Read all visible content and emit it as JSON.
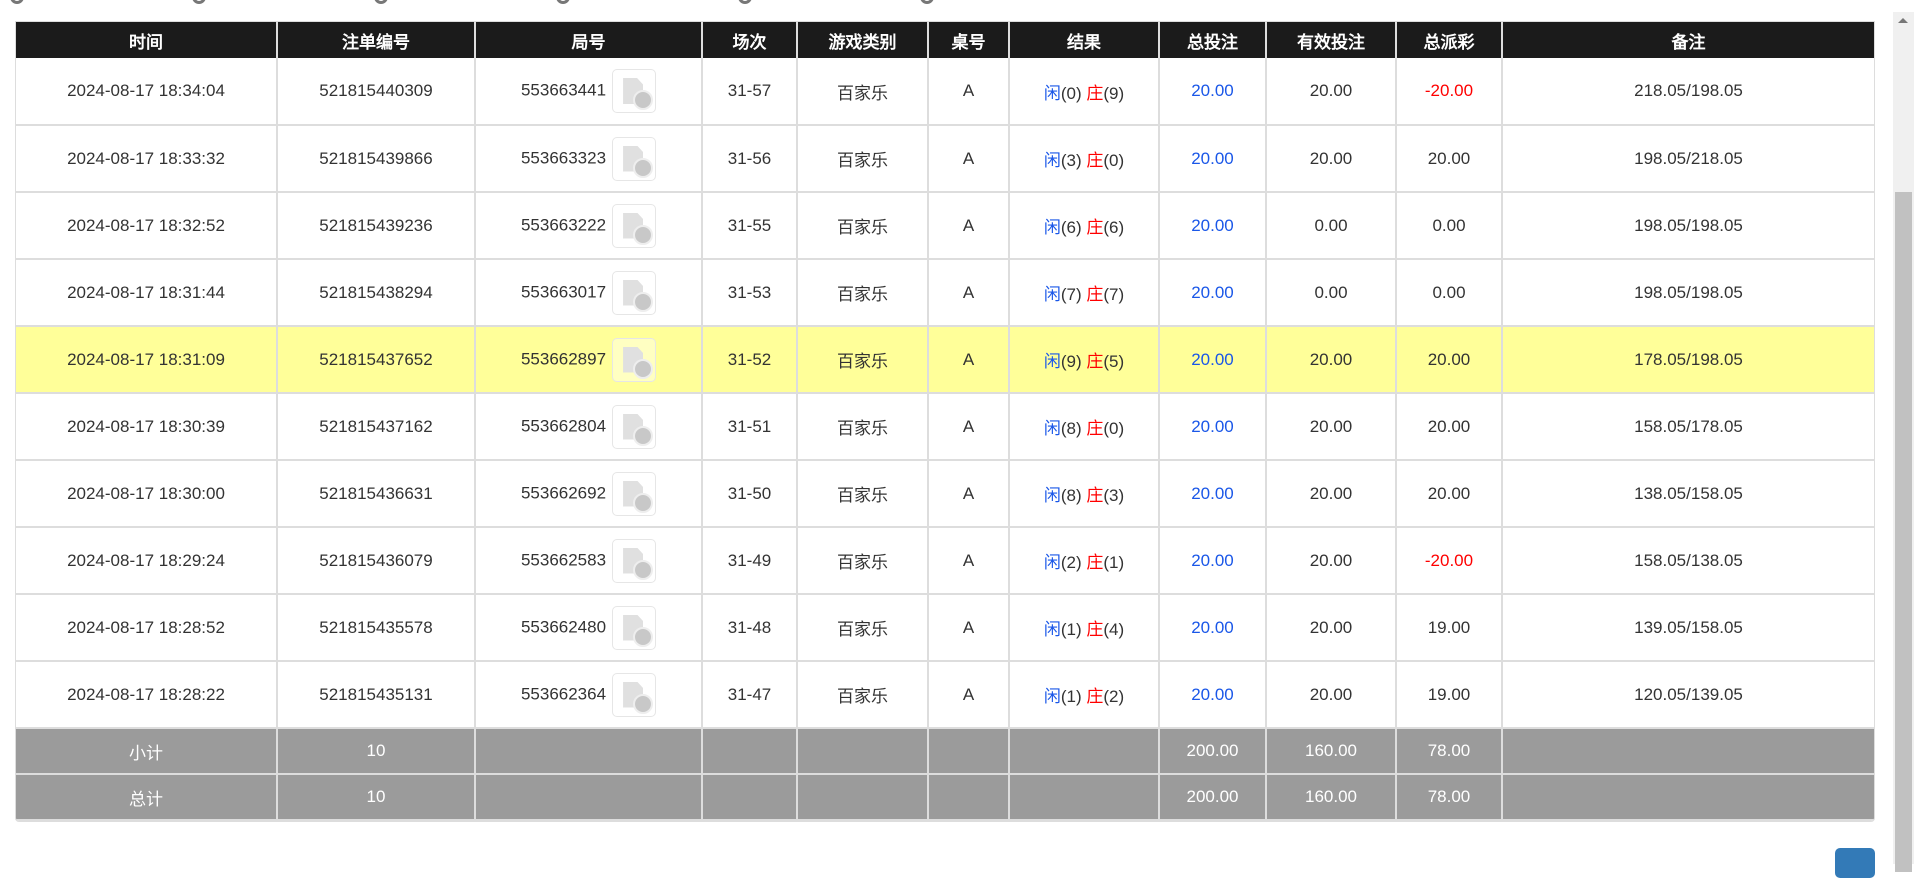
{
  "columns": [
    "时间",
    "注单编号",
    "局号",
    "场次",
    "游戏类别",
    "桌号",
    "结果",
    "总投注",
    "有效投注",
    "总派彩",
    "备注"
  ],
  "rows": [
    {
      "time": "2024-08-17 18:34:04",
      "bet_id": "521815440309",
      "round": "553663441",
      "session": "31-57",
      "game": "百家乐",
      "table": "A",
      "player": "闲",
      "player_pts": "(0)",
      "banker": "庄",
      "banker_pts": "(9)",
      "total_bet": "20.00",
      "valid_bet": "20.00",
      "payout": "-20.00",
      "payout_negative": true,
      "note": "218.05/198.05"
    },
    {
      "time": "2024-08-17 18:33:32",
      "bet_id": "521815439866",
      "round": "553663323",
      "session": "31-56",
      "game": "百家乐",
      "table": "A",
      "player": "闲",
      "player_pts": "(3)",
      "banker": "庄",
      "banker_pts": "(0)",
      "total_bet": "20.00",
      "valid_bet": "20.00",
      "payout": "20.00",
      "note": "198.05/218.05"
    },
    {
      "time": "2024-08-17 18:32:52",
      "bet_id": "521815439236",
      "round": "553663222",
      "session": "31-55",
      "game": "百家乐",
      "table": "A",
      "player": "闲",
      "player_pts": "(6)",
      "banker": "庄",
      "banker_pts": "(6)",
      "total_bet": "20.00",
      "valid_bet": "0.00",
      "payout": "0.00",
      "note": "198.05/198.05"
    },
    {
      "time": "2024-08-17 18:31:44",
      "bet_id": "521815438294",
      "round": "553663017",
      "session": "31-53",
      "game": "百家乐",
      "table": "A",
      "player": "闲",
      "player_pts": "(7)",
      "banker": "庄",
      "banker_pts": "(7)",
      "total_bet": "20.00",
      "valid_bet": "0.00",
      "payout": "0.00",
      "note": "198.05/198.05"
    },
    {
      "time": "2024-08-17 18:31:09",
      "bet_id": "521815437652",
      "round": "553662897",
      "session": "31-52",
      "game": "百家乐",
      "table": "A",
      "player": "闲",
      "player_pts": "(9)",
      "banker": "庄",
      "banker_pts": "(5)",
      "total_bet": "20.00",
      "valid_bet": "20.00",
      "payout": "20.00",
      "note": "178.05/198.05",
      "highlighted": true
    },
    {
      "time": "2024-08-17 18:30:39",
      "bet_id": "521815437162",
      "round": "553662804",
      "session": "31-51",
      "game": "百家乐",
      "table": "A",
      "player": "闲",
      "player_pts": "(8)",
      "banker": "庄",
      "banker_pts": "(0)",
      "total_bet": "20.00",
      "valid_bet": "20.00",
      "payout": "20.00",
      "note": "158.05/178.05"
    },
    {
      "time": "2024-08-17 18:30:00",
      "bet_id": "521815436631",
      "round": "553662692",
      "session": "31-50",
      "game": "百家乐",
      "table": "A",
      "player": "闲",
      "player_pts": "(8)",
      "banker": "庄",
      "banker_pts": "(3)",
      "total_bet": "20.00",
      "valid_bet": "20.00",
      "payout": "20.00",
      "note": "138.05/158.05"
    },
    {
      "time": "2024-08-17 18:29:24",
      "bet_id": "521815436079",
      "round": "553662583",
      "session": "31-49",
      "game": "百家乐",
      "table": "A",
      "player": "闲",
      "player_pts": "(2)",
      "banker": "庄",
      "banker_pts": "(1)",
      "total_bet": "20.00",
      "valid_bet": "20.00",
      "payout": "-20.00",
      "payout_negative": true,
      "note": "158.05/138.05"
    },
    {
      "time": "2024-08-17 18:28:52",
      "bet_id": "521815435578",
      "round": "553662480",
      "session": "31-48",
      "game": "百家乐",
      "table": "A",
      "player": "闲",
      "player_pts": "(1)",
      "banker": "庄",
      "banker_pts": "(4)",
      "total_bet": "20.00",
      "valid_bet": "20.00",
      "payout": "19.00",
      "note": "139.05/158.05"
    },
    {
      "time": "2024-08-17 18:28:22",
      "bet_id": "521815435131",
      "round": "553662364",
      "session": "31-47",
      "game": "百家乐",
      "table": "A",
      "player": "闲",
      "player_pts": "(1)",
      "banker": "庄",
      "banker_pts": "(2)",
      "total_bet": "20.00",
      "valid_bet": "20.00",
      "payout": "19.00",
      "note": "120.05/139.05"
    }
  ],
  "summary": [
    {
      "label": "小计",
      "count": "10",
      "total_bet": "200.00",
      "valid_bet": "160.00",
      "payout": "78.00"
    },
    {
      "label": "总计",
      "count": "10",
      "total_bet": "200.00",
      "valid_bet": "160.00",
      "payout": "78.00"
    }
  ],
  "colors": {
    "header_bg": "#1b1b1b",
    "highlight_row": "#ffff99",
    "summary_bg": "#9b9b9b",
    "player": "#1a57e8",
    "banker": "#ff0000",
    "negative": "#ff0000",
    "button": "#337ab7"
  },
  "icons": {
    "round_video": "video-file-icon"
  }
}
